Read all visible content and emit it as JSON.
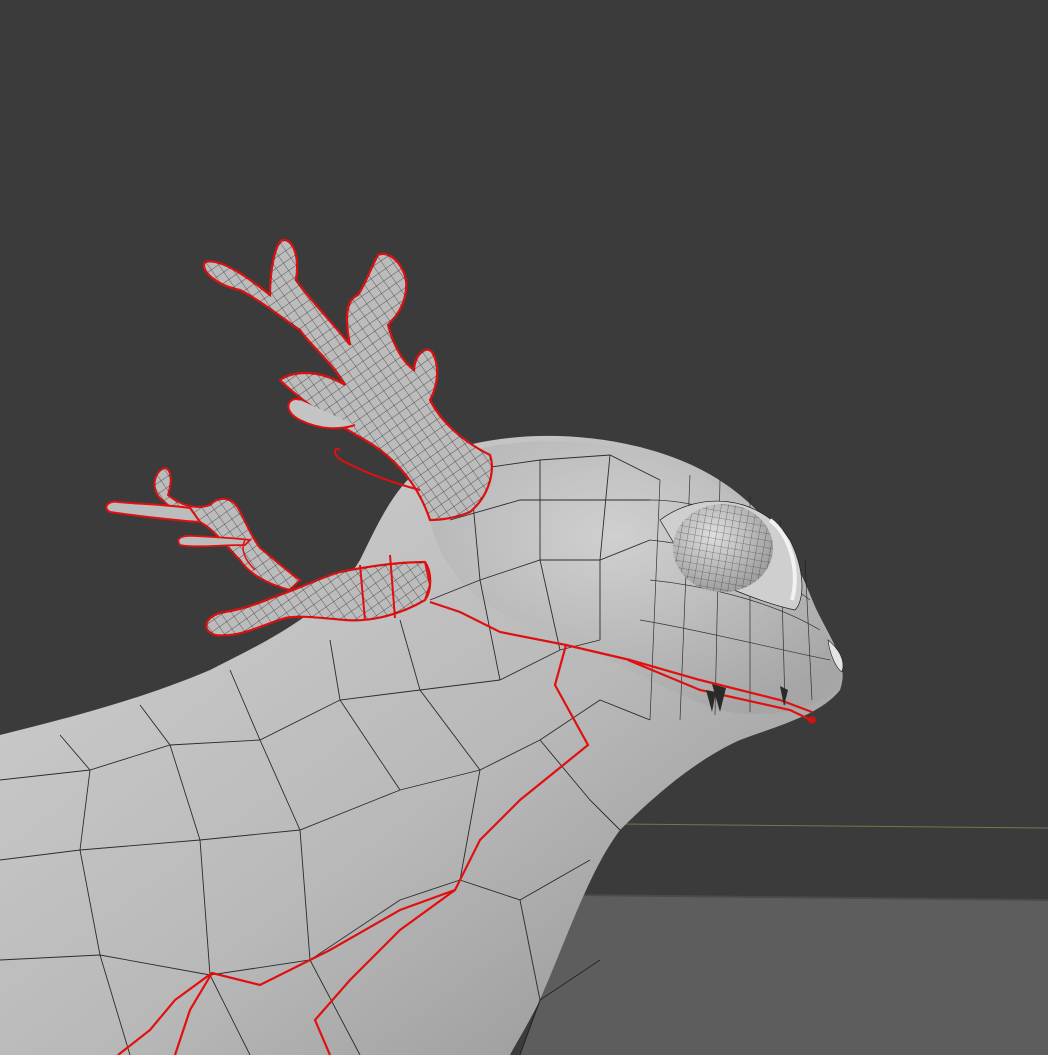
{
  "viewport": {
    "background_color": "#3b3b3b",
    "floor_color": "#5d5d5d",
    "floor_edge_color": "#4a4a4a",
    "horizon_line_color": "#6f7a4a",
    "mesh_fill_light": "#c8c8c8",
    "mesh_fill_dark": "#8e8e8e",
    "wire_color": "#1c1c1c",
    "seam_color": "#e01010",
    "shortcut_hint_icons": []
  }
}
